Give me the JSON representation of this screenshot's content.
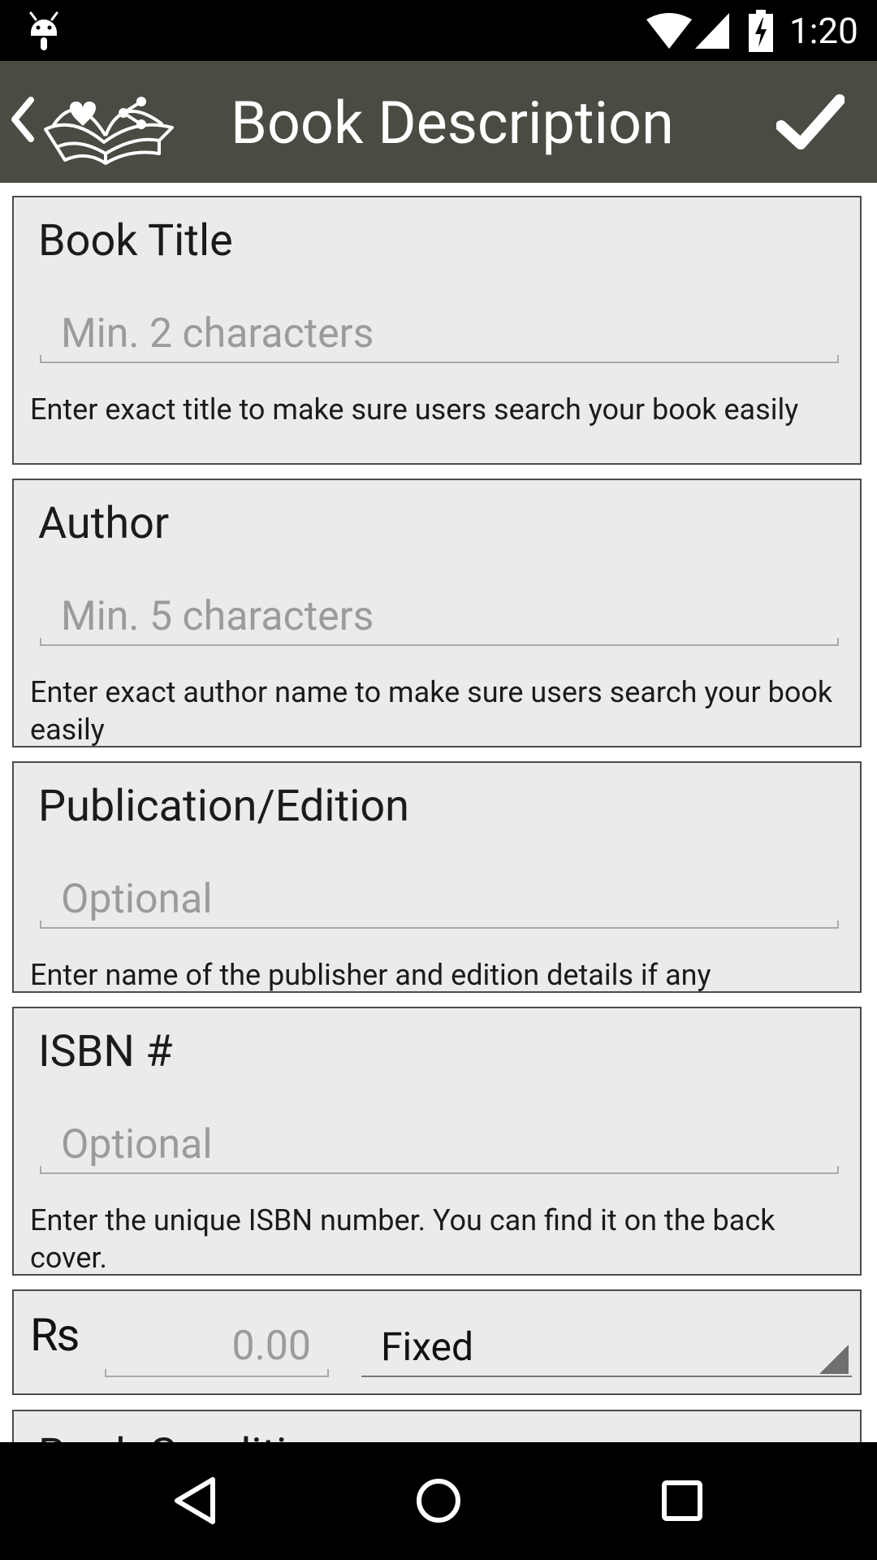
{
  "status_bar": {
    "time": "1:20",
    "icons": [
      "android-debug-icon",
      "wifi-icon",
      "cell-signal-icon",
      "battery-charging-icon"
    ]
  },
  "action_bar": {
    "title": "Book Description",
    "background_color": "#4b4b43",
    "icons": [
      "back-chevron-icon",
      "book-heart-share-logo-icon",
      "checkmark-icon"
    ]
  },
  "form": {
    "book_title": {
      "label": "Book Title",
      "placeholder": "Min. 2 characters",
      "helper": "Enter exact title to make sure users search your book easily"
    },
    "author": {
      "label": "Author",
      "placeholder": "Min. 5 characters",
      "helper": "Enter exact author name to make sure users search your book easily"
    },
    "publication": {
      "label": "Publication/Edition",
      "placeholder": "Optional",
      "helper": "Enter name of the publisher and edition details if any"
    },
    "isbn": {
      "label": "ISBN #",
      "placeholder": "Optional",
      "helper": "Enter the unique ISBN number. You can find it on the back cover."
    },
    "price": {
      "currency": "Rs",
      "placeholder": "0.00",
      "pricing_type": "Fixed"
    },
    "condition": {
      "label": "Book Conditi"
    }
  },
  "colors": {
    "card_background": "#ebebea",
    "card_border": "#4c4c4c",
    "placeholder_text": "#9b9b9b"
  },
  "nav_bar": {
    "icons": [
      "nav-back-icon",
      "nav-home-icon",
      "nav-recents-icon"
    ]
  }
}
